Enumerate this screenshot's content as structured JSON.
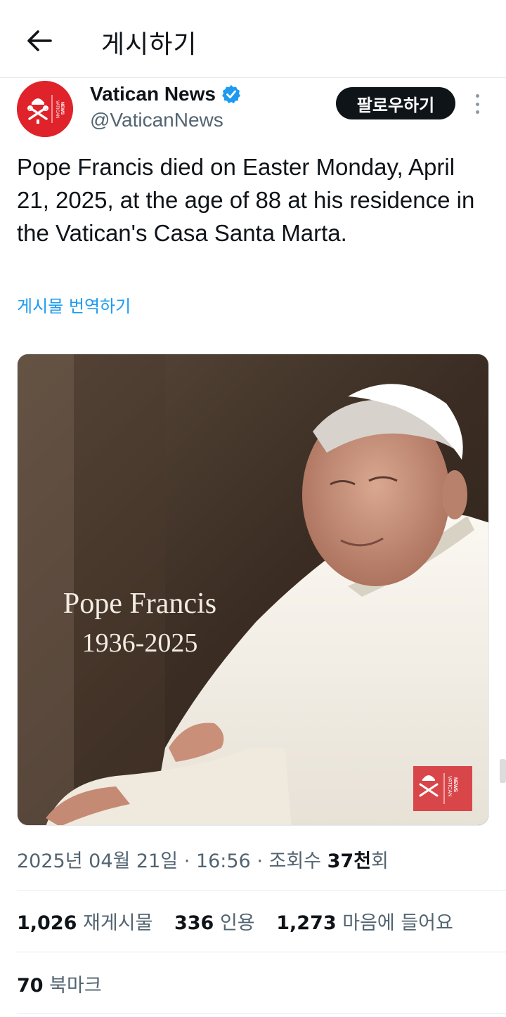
{
  "header": {
    "title": "게시하기",
    "back_icon": "arrow-left-icon"
  },
  "author": {
    "name": "Vatican News",
    "handle": "@VaticanNews",
    "verified": true,
    "avatar_text": "VATICAN NEWS",
    "follow_label": "팔로우하기"
  },
  "post": {
    "text": "Pope Francis died on Easter Monday, April 21, 2025, at the age of 88 at his residence in the Vatican's Casa Santa Marta.",
    "translate_label": "게시물 번역하기",
    "image": {
      "overlay_name": "Pope Francis",
      "overlay_years": "1936-2025",
      "logo_text": "VATICAN NEWS"
    }
  },
  "meta": {
    "date": "2025년 04월 21일",
    "separator": "·",
    "time": "16:56",
    "views_label": "조회수",
    "views_count": "37천",
    "views_suffix": "회"
  },
  "stats": {
    "reposts_count": "1,026",
    "reposts_label": "재게시물",
    "quotes_count": "336",
    "quotes_label": "인용",
    "likes_count": "1,273",
    "likes_label": "마음에 들어요",
    "bookmarks_count": "70",
    "bookmarks_label": "북마크"
  },
  "colors": {
    "accent": "#1d9bf0",
    "brand_red": "#e0232b",
    "text": "#0f1419",
    "muted": "#536471"
  }
}
